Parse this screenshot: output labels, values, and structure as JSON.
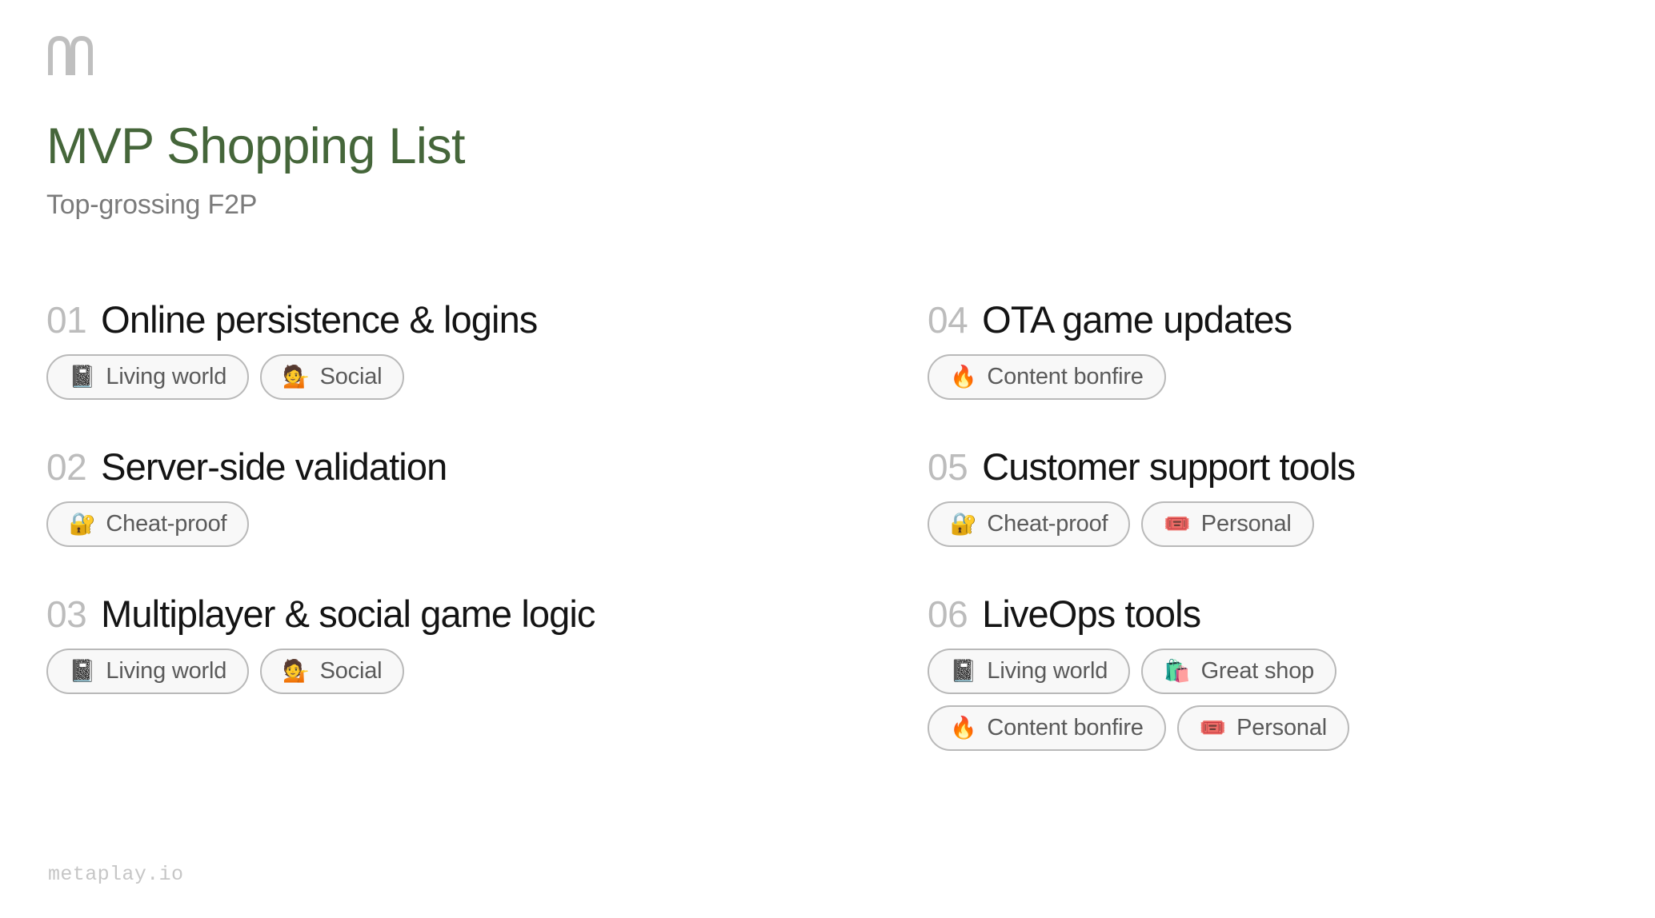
{
  "brand": {
    "logo_icon": "metaplay-m-logo-icon",
    "logo_color": "#bfbfbf",
    "footer_url": "metaplay.io"
  },
  "header": {
    "title": "MVP Shopping List",
    "subtitle": "Top-grossing F2P",
    "title_color": "#45663a",
    "subtitle_color": "#7b7b7b"
  },
  "colors": {
    "number": "#bcbcbc",
    "item_title": "#141414",
    "tag_border": "#b9b9b9",
    "tag_background": "#f8f8f8",
    "tag_text": "#5a5a5a",
    "footer_text": "#c6c6c6",
    "page_background": "#ffffff"
  },
  "columns": {
    "left": [
      {
        "number": "01",
        "title": "Online persistence & logins",
        "tags": [
          {
            "emoji": "📓",
            "icon": "notebook-icon",
            "label": "Living world"
          },
          {
            "emoji": "💁",
            "icon": "person-tipping-hand-icon",
            "label": "Social"
          }
        ]
      },
      {
        "number": "02",
        "title": "Server-side validation",
        "tags": [
          {
            "emoji": "🔐",
            "icon": "locked-with-key-icon",
            "label": "Cheat-proof"
          }
        ]
      },
      {
        "number": "03",
        "title": "Multiplayer & social game logic",
        "tags": [
          {
            "emoji": "📓",
            "icon": "notebook-icon",
            "label": "Living world"
          },
          {
            "emoji": "💁",
            "icon": "person-tipping-hand-icon",
            "label": "Social"
          }
        ]
      }
    ],
    "right": [
      {
        "number": "04",
        "title": "OTA game updates",
        "tags": [
          {
            "emoji": "🔥",
            "icon": "fire-icon",
            "label": "Content bonfire"
          }
        ]
      },
      {
        "number": "05",
        "title": "Customer support tools",
        "tags": [
          {
            "emoji": "🔐",
            "icon": "locked-with-key-icon",
            "label": "Cheat-proof"
          },
          {
            "emoji": "🎟️",
            "icon": "admission-ticket-icon",
            "label": "Personal"
          }
        ]
      },
      {
        "number": "06",
        "title": "LiveOps tools",
        "tags": [
          {
            "emoji": "📓",
            "icon": "notebook-icon",
            "label": "Living world"
          },
          {
            "emoji": "🛍️",
            "icon": "shopping-bags-icon",
            "label": "Great shop"
          },
          {
            "emoji": "🔥",
            "icon": "fire-icon",
            "label": "Content bonfire"
          },
          {
            "emoji": "🎟️",
            "icon": "admission-ticket-icon",
            "label": "Personal"
          }
        ]
      }
    ]
  }
}
